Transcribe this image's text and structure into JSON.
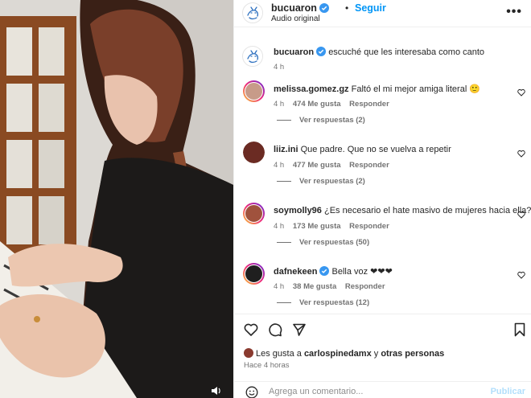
{
  "post": {
    "username": "bucuaron",
    "follow_label": "Seguir",
    "separator": "•",
    "audio": "Audio original",
    "more_icon": "more-horizontal-icon",
    "caption": {
      "username": "bucuaron",
      "text": "escuché que les interesaba como canto",
      "age": "4 h"
    }
  },
  "comments": [
    {
      "username": "melissa.gomez.gz",
      "text": "Faltó el mi mejor amiga literal 🙂",
      "age": "4 h",
      "likes": "474 Me gusta",
      "reply": "Responder",
      "view_replies": "Ver respuestas (2)",
      "verified": false,
      "story_ring": true,
      "avatar_color": "#c79b89"
    },
    {
      "username": "liiz.ini",
      "text": "Que padre. Que no se vuelva a repetir",
      "age": "4 h",
      "likes": "477 Me gusta",
      "reply": "Responder",
      "view_replies": "Ver respuestas (2)",
      "verified": false,
      "story_ring": false,
      "avatar_color": "#6b2b23"
    },
    {
      "username": "soymolly96",
      "text": "¿Es necesario el hate masivo de mujeres hacia ella?",
      "age": "4 h",
      "likes": "173 Me gusta",
      "reply": "Responder",
      "view_replies": "Ver respuestas (50)",
      "verified": false,
      "story_ring": true,
      "avatar_color": "#a0523d"
    },
    {
      "username": "dafnekeen",
      "text": "Bella voz ❤❤❤",
      "age": "4 h",
      "likes": "38 Me gusta",
      "reply": "Responder",
      "view_replies": "Ver respuestas (12)",
      "verified": true,
      "story_ring": true,
      "avatar_color": "#1f1f1f"
    }
  ],
  "actions": {
    "like_icon": "heart-outline-icon",
    "comment_icon": "comment-bubble-icon",
    "share_icon": "paper-plane-icon",
    "save_icon": "bookmark-icon"
  },
  "likes_line": {
    "prefix": "Les gusta a",
    "user": "carlospinedamx",
    "middle": "y",
    "others": "otras personas"
  },
  "timestamp": "Hace 4 horas",
  "add_comment": {
    "placeholder": "Agrega un comentario...",
    "publish_label": "Publicar",
    "emoji_icon": "emoji-smile-icon"
  },
  "colors": {
    "accent": "#0095f6",
    "verified": "#3897f0",
    "text": "#262626",
    "muted": "#737373",
    "publish_disabled": "#b2dffc",
    "heart_red": "#ed4956"
  },
  "media": {
    "volume_icon": "volume-icon"
  }
}
